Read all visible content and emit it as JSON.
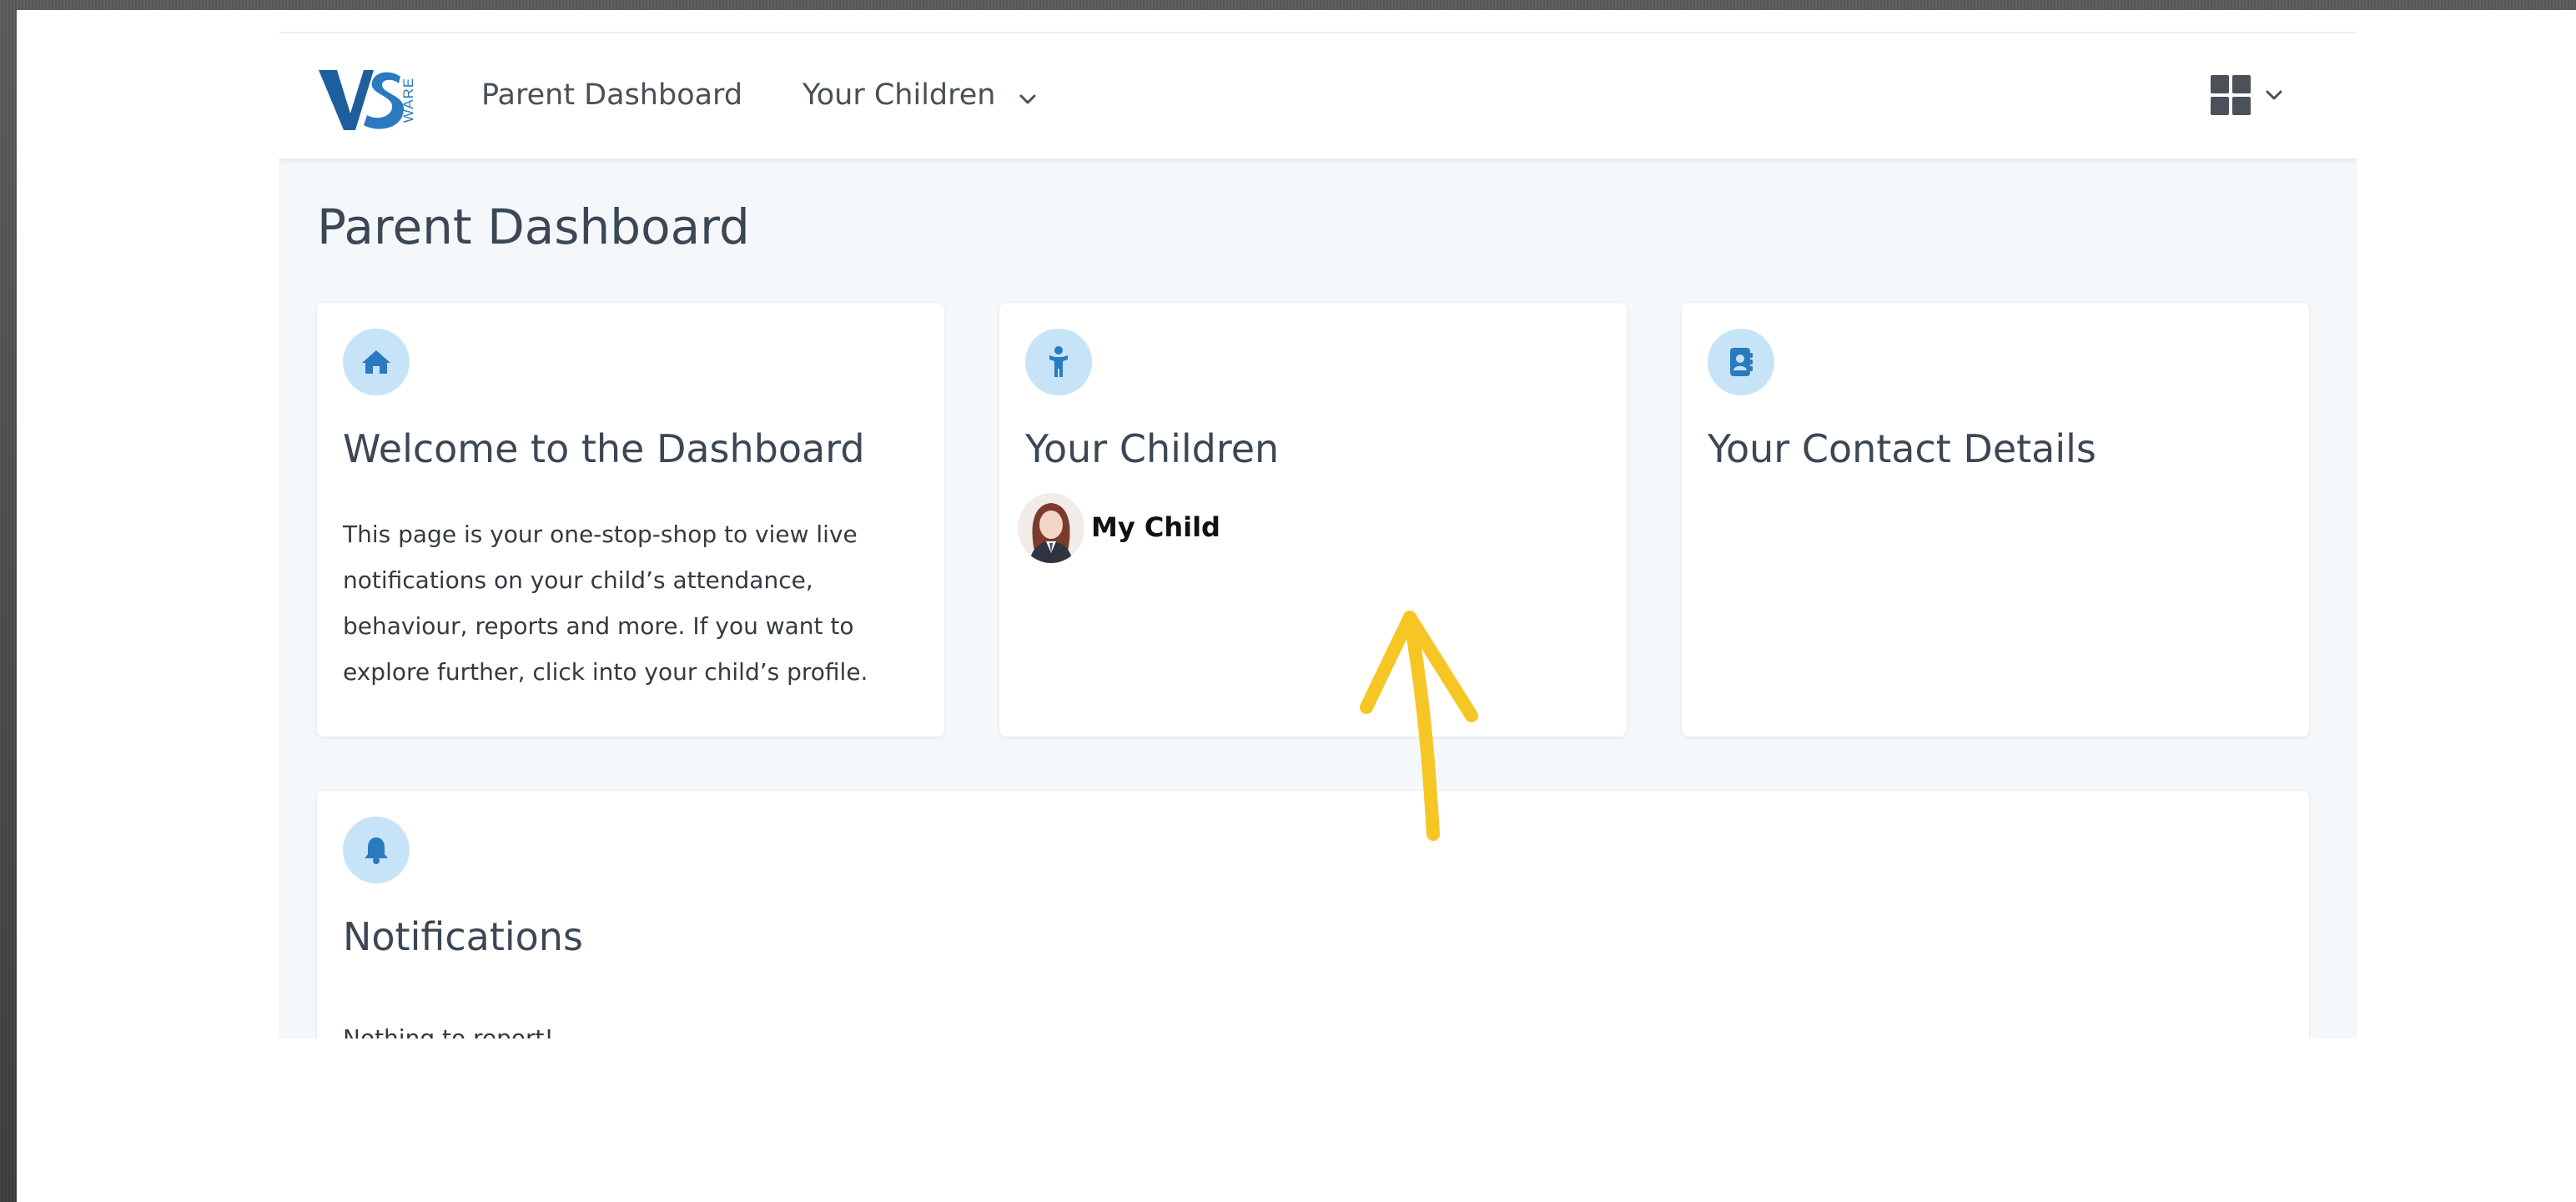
{
  "header": {
    "logo_text": "VS WARE",
    "nav": {
      "dashboard_label": "Parent Dashboard",
      "children_label": "Your Children"
    },
    "icons": {
      "children_dropdown": "chevron-down-icon",
      "apps_menu": "grid-icon",
      "apps_dropdown": "chevron-down-icon"
    }
  },
  "page": {
    "title": "Parent Dashboard"
  },
  "cards": {
    "welcome": {
      "icon": "home-icon",
      "title": "Welcome to the Dashboard",
      "text": "This page is your one-stop-shop to view live notifications on your child’s attendance, behaviour, reports and more. If you want to explore further, click into your child’s profile."
    },
    "children": {
      "icon": "child-icon",
      "title": "Your Children",
      "child_name": "My Child"
    },
    "contact": {
      "icon": "address-book-icon",
      "title": "Your Contact Details"
    },
    "notifications": {
      "icon": "bell-icon",
      "title": "Notifications",
      "text": "Nothing to report!"
    }
  },
  "colors": {
    "accent_blue": "#2a7ac0",
    "icon_bg": "#c7e3f8",
    "page_bg": "#f4f8fa",
    "annotation_yellow": "#f6c625"
  }
}
